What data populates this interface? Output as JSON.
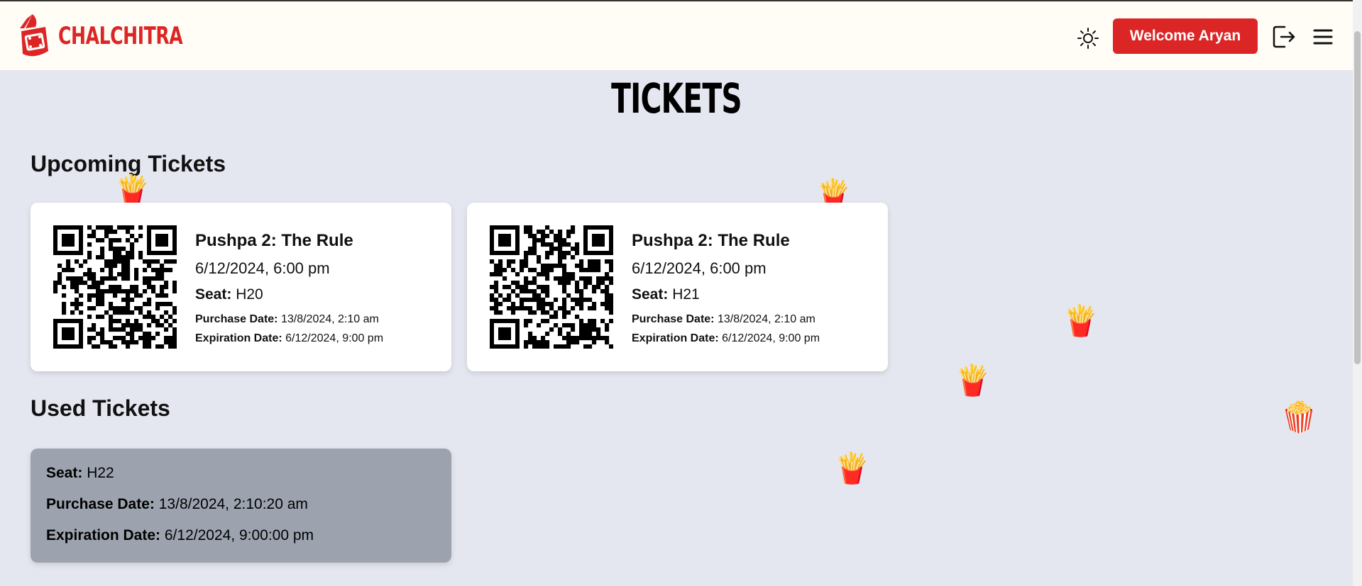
{
  "app": {
    "name": "CHALCHITRA"
  },
  "header": {
    "welcome_label": "Welcome Aryan"
  },
  "page": {
    "title": "TICKETS"
  },
  "upcoming": {
    "heading": "Upcoming Tickets",
    "tickets": [
      {
        "movie": "Pushpa 2: The Rule",
        "showtime": "6/12/2024, 6:00 pm",
        "seat_label": "Seat:",
        "seat": "H20",
        "purchase_label": "Purchase Date:",
        "purchase_date": "13/8/2024, 2:10 am",
        "expiration_label": "Expiration Date:",
        "expiration_date": "6/12/2024, 9:00 pm"
      },
      {
        "movie": "Pushpa 2: The Rule",
        "showtime": "6/12/2024, 6:00 pm",
        "seat_label": "Seat:",
        "seat": "H21",
        "purchase_label": "Purchase Date:",
        "purchase_date": "13/8/2024, 2:10 am",
        "expiration_label": "Expiration Date:",
        "expiration_date": "6/12/2024, 9:00 pm"
      }
    ]
  },
  "used": {
    "heading": "Used Tickets",
    "tickets": [
      {
        "seat_label": "Seat:",
        "seat": "H22",
        "purchase_label": "Purchase Date:",
        "purchase_date": "13/8/2024, 2:10:20 am",
        "expiration_label": "Expiration Date:",
        "expiration_date": "6/12/2024, 9:00:00 pm"
      }
    ]
  },
  "decorations": {
    "fries": "🍟",
    "popcorn": "🍿"
  },
  "colors": {
    "brand": "#dc2626",
    "page_bg": "#e5e7f0",
    "navbar_bg": "#fffdf6",
    "used_card_bg": "#9ca3af"
  },
  "icons": [
    "logo-icon",
    "sun-icon",
    "logout-icon",
    "hamburger-menu-icon",
    "qr-code-icon"
  ]
}
